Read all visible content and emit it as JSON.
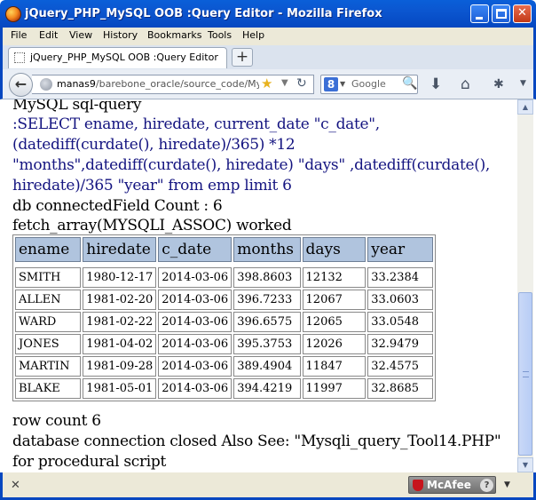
{
  "window": {
    "title": "jQuery_PHP_MySQL OOB :Query Editor - Mozilla Firefox",
    "minimize_label": "_",
    "close_label": "✕"
  },
  "menu": [
    "File",
    "Edit",
    "View",
    "History",
    "Bookmarks",
    "Tools",
    "Help"
  ],
  "tab": {
    "label": "jQuery_PHP_MySQL OOB :Query Editor",
    "new_tab_label": "+"
  },
  "nav": {
    "url_host": "manas9",
    "url_path": "/barebone_oracle/source_code/Mysqli_",
    "search_engine_letter": "8",
    "search_placeholder": "Google"
  },
  "content": {
    "heading": "MySQL sql-query",
    "query_lines": [
      ":SELECT ename, hiredate, current_date \"c_date\",",
      "(datediff(curdate(), hiredate)/365) *12",
      "\"months\",datediff(curdate(), hiredate) \"days\" ,datediff(curdate(),",
      "hiredate)/365 \"year\" from emp limit 6"
    ],
    "connected_line": "db connectedField Count : 6",
    "fetch_line": "fetch_array(MYSQLI_ASSOC) worked",
    "table": {
      "headers": [
        "ename",
        "hiredate",
        "c_date",
        "months",
        "days",
        "year"
      ],
      "rows": [
        [
          "SMITH",
          "1980-12-17",
          "2014-03-06",
          "398.8603",
          "12132",
          "33.2384"
        ],
        [
          "ALLEN",
          "1981-02-20",
          "2014-03-06",
          "396.7233",
          "12067",
          "33.0603"
        ],
        [
          "WARD",
          "1981-02-22",
          "2014-03-06",
          "396.6575",
          "12065",
          "33.0548"
        ],
        [
          "JONES",
          "1981-04-02",
          "2014-03-06",
          "395.3753",
          "12026",
          "32.9479"
        ],
        [
          "MARTIN",
          "1981-09-28",
          "2014-03-06",
          "389.4904",
          "11847",
          "32.4575"
        ],
        [
          "BLAKE",
          "1981-05-01",
          "2014-03-06",
          "394.4219",
          "11997",
          "32.8685"
        ]
      ]
    },
    "row_count": "row count 6",
    "closed_line": "database connection closed Also See: \"Mysqli_query_Tool14.PHP\"",
    "procedural_line": "for procedural script"
  },
  "statusbar": {
    "close_label": "✕",
    "mcafee_label": "McAfee",
    "help_label": "?"
  }
}
